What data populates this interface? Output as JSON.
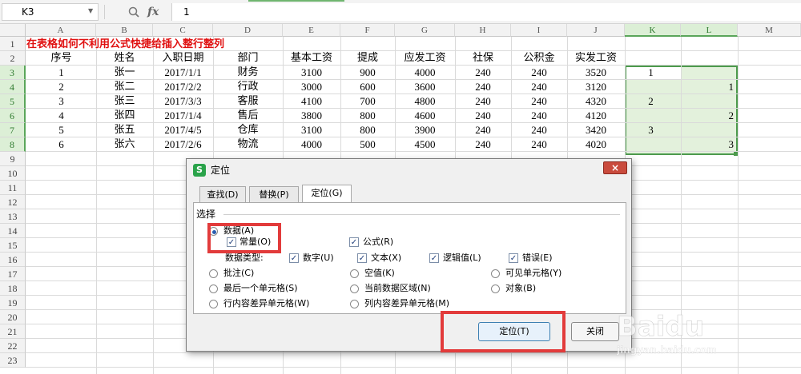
{
  "formula_bar": {
    "name_box": "K3",
    "fx_symbol": "fx",
    "value": "1"
  },
  "columns": [
    "A",
    "B",
    "C",
    "D",
    "E",
    "F",
    "G",
    "H",
    "I",
    "J",
    "K",
    "L",
    "M"
  ],
  "rows": [
    "1",
    "2",
    "3",
    "4",
    "5",
    "6",
    "7",
    "8",
    "9",
    "10",
    "11",
    "12",
    "13",
    "14",
    "15",
    "16",
    "17",
    "18",
    "19",
    "20",
    "21",
    "22",
    "23"
  ],
  "sheet": {
    "title": "在表格如何不利用公式快捷给插入整行整列",
    "headers": [
      "序号",
      "姓名",
      "入职日期",
      "部门",
      "基本工资",
      "提成",
      "应发工资",
      "社保",
      "公积金",
      "实发工资"
    ],
    "data": [
      [
        "1",
        "张一",
        "2017/1/1",
        "财务",
        "3100",
        "900",
        "4000",
        "240",
        "240",
        "3520"
      ],
      [
        "2",
        "张二",
        "2017/2/2",
        "行政",
        "3000",
        "600",
        "3600",
        "240",
        "240",
        "3120"
      ],
      [
        "3",
        "张三",
        "2017/3/3",
        "客服",
        "4100",
        "700",
        "4800",
        "240",
        "240",
        "4320"
      ],
      [
        "4",
        "张四",
        "2017/1/4",
        "售后",
        "3800",
        "800",
        "4600",
        "240",
        "240",
        "4120"
      ],
      [
        "5",
        "张五",
        "2017/4/5",
        "仓库",
        "3100",
        "800",
        "3900",
        "240",
        "240",
        "3420"
      ],
      [
        "6",
        "张六",
        "2017/2/6",
        "物流",
        "4000",
        "500",
        "4500",
        "240",
        "240",
        "4020"
      ]
    ],
    "k_values": [
      "1",
      "",
      "2",
      "",
      "3",
      ""
    ],
    "l_values": [
      "",
      "1",
      "",
      "2",
      "",
      "3"
    ]
  },
  "dialog": {
    "title": "定位",
    "close": "×",
    "tabs": [
      "查找(D)",
      "替换(P)",
      "定位(G)"
    ],
    "section": "选择",
    "opt_data": "数据(A)",
    "opt_constant": "常量(O)",
    "opt_formula": "公式(R)",
    "data_type_label": "数据类型:",
    "types": [
      "数字(U)",
      "文本(X)",
      "逻辑值(L)",
      "错误(E)"
    ],
    "opt_comment": "批注(C)",
    "opt_blank": "空值(K)",
    "opt_visible": "可见单元格(Y)",
    "opt_last_cell": "最后一个单元格(S)",
    "opt_current_region": "当前数据区域(N)",
    "opt_object": "对象(B)",
    "opt_row_diff": "行内容差异单元格(W)",
    "opt_col_diff": "列内容差异单元格(M)",
    "btn_locate": "定位(T)",
    "btn_close": "关闭"
  },
  "watermark": {
    "text": "Baidu经验",
    "sub": "jingyan.baidu.com"
  },
  "colors": {
    "selection_border": "#4c9a4c",
    "highlight": "#e23b3b",
    "title_red": "#e01010"
  }
}
